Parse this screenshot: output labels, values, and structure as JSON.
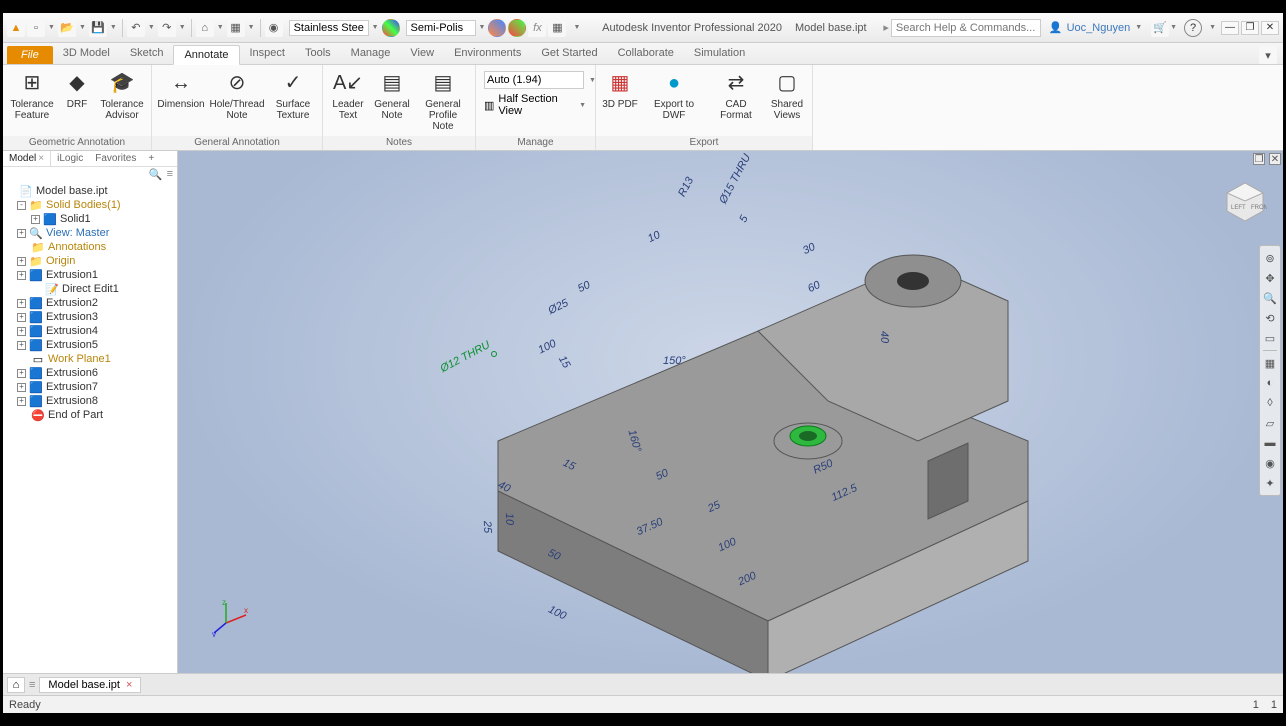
{
  "app_title": "Autodesk Inventor Professional 2020",
  "document_name": "Model base.ipt",
  "search_placeholder": "Search Help & Commands...",
  "user_name": "Uoc_Nguyen",
  "material": "Stainless Stee",
  "appearance": "Semi-Polis",
  "ribbon_tabs": {
    "file": "File",
    "items": [
      "3D Model",
      "Sketch",
      "Annotate",
      "Inspect",
      "Tools",
      "Manage",
      "View",
      "Environments",
      "Get Started",
      "Collaborate",
      "Simulation"
    ],
    "active_index": 2
  },
  "ribbon": {
    "panels": {
      "geom": {
        "title": "Geometric Annotation",
        "btns": {
          "tol_feature": "Tolerance\nFeature",
          "drf": "DRF",
          "tol_advisor": "Tolerance\nAdvisor"
        }
      },
      "gen": {
        "title": "General Annotation",
        "btns": {
          "dimension": "Dimension",
          "hole": "Hole/Thread\nNote",
          "surface": "Surface\nTexture"
        }
      },
      "notes": {
        "title": "Notes",
        "btns": {
          "leader": "Leader\nText",
          "general": "General\nNote",
          "profile": "General\nProfile Note"
        }
      },
      "manage": {
        "title": "Manage",
        "scale": "Auto (1.94)",
        "section": "Half Section View"
      },
      "export": {
        "title": "Export",
        "btns": {
          "pdf": "3D PDF",
          "dwf": "Export to DWF",
          "cad": "CAD Format",
          "shared": "Shared\nViews"
        }
      }
    }
  },
  "browser": {
    "tabs": {
      "model": "Model",
      "ilogic": "iLogic",
      "favorites": "Favorites"
    },
    "tree": [
      {
        "indent": 0,
        "toggle": "",
        "icon": "📄",
        "label": "Model base.ipt",
        "color": "#333"
      },
      {
        "indent": 1,
        "toggle": "-",
        "icon": "📁",
        "label": "Solid Bodies(1)",
        "color": "#b8860b"
      },
      {
        "indent": 2,
        "toggle": "+",
        "icon": "🟦",
        "label": "Solid1",
        "color": "#333"
      },
      {
        "indent": 1,
        "toggle": "+",
        "icon": "🔍",
        "label": "View: Master",
        "color": "#2a6fb5"
      },
      {
        "indent": 1,
        "toggle": "",
        "icon": "📁",
        "label": "Annotations",
        "color": "#b8860b"
      },
      {
        "indent": 1,
        "toggle": "+",
        "icon": "📁",
        "label": "Origin",
        "color": "#b8860b"
      },
      {
        "indent": 1,
        "toggle": "+",
        "icon": "🟦",
        "label": "Extrusion1",
        "color": "#333"
      },
      {
        "indent": 2,
        "toggle": "",
        "icon": "📝",
        "label": "Direct Edit1",
        "color": "#333"
      },
      {
        "indent": 1,
        "toggle": "+",
        "icon": "🟦",
        "label": "Extrusion2",
        "color": "#333"
      },
      {
        "indent": 1,
        "toggle": "+",
        "icon": "🟦",
        "label": "Extrusion3",
        "color": "#333"
      },
      {
        "indent": 1,
        "toggle": "+",
        "icon": "🟦",
        "label": "Extrusion4",
        "color": "#333"
      },
      {
        "indent": 1,
        "toggle": "+",
        "icon": "🟦",
        "label": "Extrusion5",
        "color": "#333"
      },
      {
        "indent": 1,
        "toggle": "",
        "icon": "▭",
        "label": "Work Plane1",
        "color": "#b8860b"
      },
      {
        "indent": 1,
        "toggle": "+",
        "icon": "🟦",
        "label": "Extrusion6",
        "color": "#333"
      },
      {
        "indent": 1,
        "toggle": "+",
        "icon": "🟦",
        "label": "Extrusion7",
        "color": "#333"
      },
      {
        "indent": 1,
        "toggle": "+",
        "icon": "🟦",
        "label": "Extrusion8",
        "color": "#333"
      },
      {
        "indent": 1,
        "toggle": "",
        "icon": "⛔",
        "label": "End of Part",
        "color": "#333"
      }
    ]
  },
  "dimensions": {
    "d12thru": "Ø12 THRU",
    "r13": "R13",
    "d15thru": "Ø15 THRU",
    "v5": "5",
    "v10a": "10",
    "v30": "30",
    "v60": "60",
    "v40r": "40",
    "v50a": "50",
    "d25": "Ø25",
    "v100a": "100",
    "a150": "150°",
    "r50": "R50",
    "v1125": "112.5",
    "a160": "160°",
    "v15": "15",
    "v50b": "50",
    "v25b": "25",
    "v3750": "37.50",
    "v100b": "100",
    "v200": "200",
    "v40l": "40",
    "v25l": "25",
    "v10l": "10",
    "v50l": "50",
    "v100bot": "100",
    "v15b": "15"
  },
  "doc_tab": "Model base.ipt",
  "status": {
    "left": "Ready",
    "r1": "1",
    "r2": "1"
  }
}
